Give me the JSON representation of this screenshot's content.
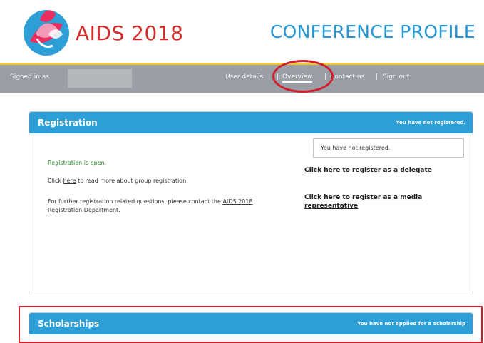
{
  "header": {
    "brand": "AIDS 2018",
    "profile_title": "CONFERENCE PROFILE"
  },
  "nav": {
    "signed_in_label": "Signed in as",
    "links": [
      "User details",
      "Overview",
      "Contact us",
      "Sign out"
    ],
    "separator": "|"
  },
  "registration": {
    "title": "Registration",
    "status": "You have not registered.",
    "open_text": "Registration is open.",
    "group_pre": "Click ",
    "group_link": "here",
    "group_post": " to read more about group registration.",
    "further_pre": "For further registration related questions, please contact the ",
    "further_link": "AIDS 2018 Registration Department",
    "further_post": ".",
    "status_box": "You have not registered.",
    "delegate_link": "Click here to register as a delegate",
    "media_link": "Click here to register as a media representative"
  },
  "scholarships": {
    "title": "Scholarships",
    "status": "You have not applied for a scholarship"
  },
  "colors": {
    "brand_red": "#d42b2b",
    "title_blue": "#2596d1",
    "card_header_blue": "#2e9fd6",
    "nav_gray": "#9a9fa6",
    "highlight_red": "#d01f2a",
    "open_green": "#2a8e2a"
  }
}
